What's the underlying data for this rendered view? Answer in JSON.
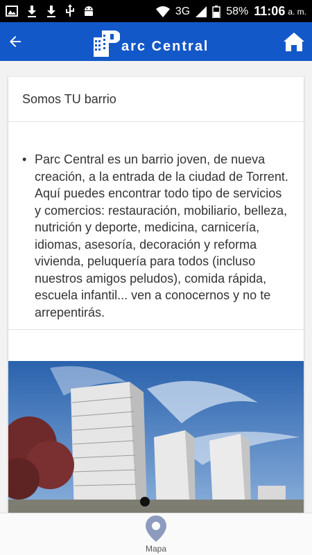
{
  "status_bar": {
    "network": "3G",
    "battery": "58%",
    "time": "11:06",
    "ampm": "a. m."
  },
  "app_bar": {
    "title": "arc Central"
  },
  "card": {
    "header": "Somos TU barrio",
    "bullet": "•",
    "description": "Parc Central es un barrio joven, de nueva creación, a la entrada de la ciudad de Torrent. Aquí puedes encontrar todo tipo de servicios y comercios: restauración, mobiliario, belleza, nutrición y deporte, medicina, carnicería, idiomas, asesoría, decoración y reforma vivienda, peluquería para todos (incluso nuestros amigos peludos), comida rápida, escuela infantil... ven a conocernos y no te arrepentirás."
  },
  "bottom_nav": {
    "map_label": "Mapa"
  },
  "colors": {
    "primary": "#1358c8",
    "map_icon": "#8d9bbf"
  }
}
